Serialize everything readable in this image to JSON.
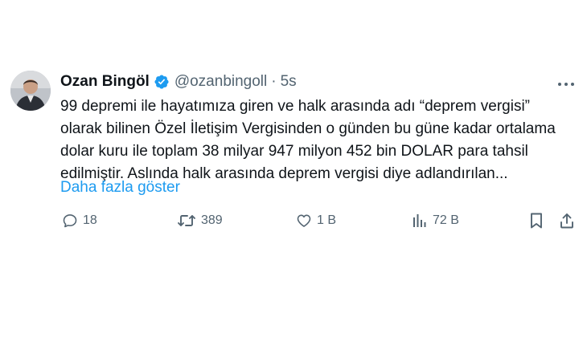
{
  "author": {
    "name": "Ozan Bingöl",
    "handle": "@ozanbingoll",
    "separator": "·",
    "time": "5s",
    "verified": true
  },
  "tweet": {
    "lines": [
      "99 depremi ile hayatımıza giren ve halk arasında adı “deprem vergisi”",
      "olarak bilinen Özel İletişim Vergisinden o günden bu güne kadar ortalama",
      "dolar kuru ile toplam 38 milyar 947 milyon 452 bin DOLAR para tahsil",
      "edilmiştir. Aslında halk arasında deprem vergisi diye adlandırılan..."
    ],
    "show_more": "Daha fazla göster"
  },
  "actions": {
    "replies": "18",
    "retweets": "389",
    "likes": "1 B",
    "views": "72 B"
  },
  "colors": {
    "text": "#0f1419",
    "secondary": "#536471",
    "link": "#1d9bf0",
    "verified": "#1d9bf0"
  },
  "icons": [
    "more-icon",
    "verified-badge-icon",
    "reply-icon",
    "retweet-icon",
    "like-icon",
    "views-icon",
    "bookmark-icon",
    "share-icon"
  ]
}
